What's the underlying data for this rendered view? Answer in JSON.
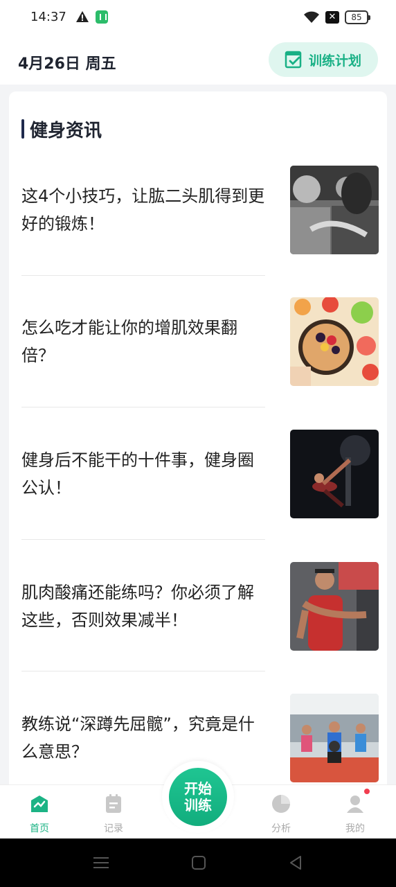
{
  "status_bar": {
    "time": "14:37",
    "battery": "85",
    "icons": [
      "warning-icon",
      "app-notification-icon",
      "wifi-icon",
      "no-sim-icon",
      "battery-icon"
    ]
  },
  "header": {
    "date": "4月26日 周五",
    "plan_button_label": "训练计划"
  },
  "section": {
    "title": "健身资讯"
  },
  "news": [
    {
      "title": "这4个小技巧，让肱二头肌得到更好的锻炼！"
    },
    {
      "title": "怎么吃才能让你的增肌效果翻倍？"
    },
    {
      "title": "健身后不能干的十件事，健身圈公认！"
    },
    {
      "title": "肌肉酸痛还能练吗？你必须了解这些，否则效果减半！"
    },
    {
      "title": "教练说“深蹲先屈髋”，究竟是什么意思？"
    }
  ],
  "tabbar": {
    "home": "首页",
    "records": "记录",
    "start": "开始训练",
    "analysis": "分析",
    "mine": "我的"
  },
  "colors": {
    "accent": "#1cb385",
    "accent_light": "#dff6ef",
    "badge": "#f23d4f"
  }
}
